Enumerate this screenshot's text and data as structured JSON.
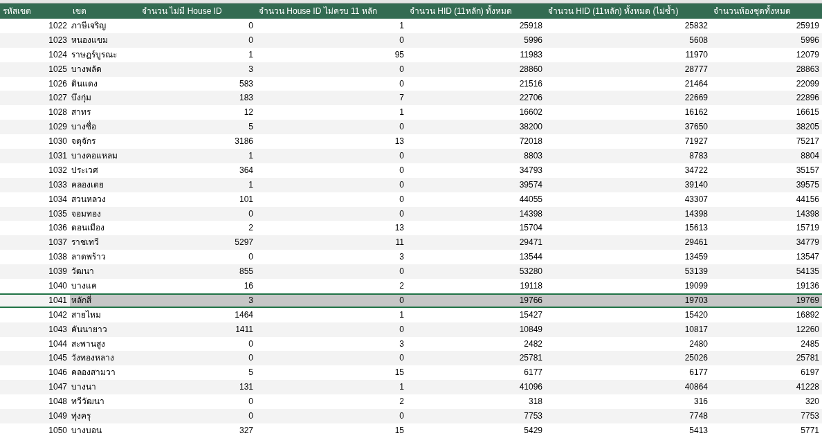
{
  "table": {
    "columns": [
      "รหัสเขต",
      "เขต",
      "จำนวน ไม่มี House ID",
      "จำนวน House ID ไม่ครบ 11 หลัก",
      "จำนวน HID (11หลัก) ทั้งหมด",
      "จำนวน HID (11หลัก) ทั้งหมด (ไม่ซ้ำ)",
      "จำนวนห้องชุดทั้งหมด"
    ],
    "rows": [
      {
        "cells": [
          "1022",
          "ภาษีเจริญ",
          "0",
          "1",
          "25918",
          "25832",
          "25919"
        ],
        "selected": false
      },
      {
        "cells": [
          "1023",
          "หนองแขม",
          "0",
          "0",
          "5996",
          "5608",
          "5996"
        ],
        "selected": false
      },
      {
        "cells": [
          "1024",
          "ราษฎร์บูรณะ",
          "1",
          "95",
          "11983",
          "11970",
          "12079"
        ],
        "selected": false
      },
      {
        "cells": [
          "1025",
          "บางพลัด",
          "3",
          "0",
          "28860",
          "28777",
          "28863"
        ],
        "selected": false
      },
      {
        "cells": [
          "1026",
          "ดินแดง",
          "583",
          "0",
          "21516",
          "21464",
          "22099"
        ],
        "selected": false
      },
      {
        "cells": [
          "1027",
          "บึงกุ่ม",
          "183",
          "7",
          "22706",
          "22669",
          "22896"
        ],
        "selected": false
      },
      {
        "cells": [
          "1028",
          "สาทร",
          "12",
          "1",
          "16602",
          "16162",
          "16615"
        ],
        "selected": false
      },
      {
        "cells": [
          "1029",
          "บางซื่อ",
          "5",
          "0",
          "38200",
          "37650",
          "38205"
        ],
        "selected": false
      },
      {
        "cells": [
          "1030",
          "จตุจักร",
          "3186",
          "13",
          "72018",
          "71927",
          "75217"
        ],
        "selected": false
      },
      {
        "cells": [
          "1031",
          "บางคอแหลม",
          "1",
          "0",
          "8803",
          "8783",
          "8804"
        ],
        "selected": false
      },
      {
        "cells": [
          "1032",
          "ประเวศ",
          "364",
          "0",
          "34793",
          "34722",
          "35157"
        ],
        "selected": false
      },
      {
        "cells": [
          "1033",
          "คลองเตย",
          "1",
          "0",
          "39574",
          "39140",
          "39575"
        ],
        "selected": false
      },
      {
        "cells": [
          "1034",
          "สวนหลวง",
          "101",
          "0",
          "44055",
          "43307",
          "44156"
        ],
        "selected": false
      },
      {
        "cells": [
          "1035",
          "จอมทอง",
          "0",
          "0",
          "14398",
          "14398",
          "14398"
        ],
        "selected": false
      },
      {
        "cells": [
          "1036",
          "ดอนเมือง",
          "2",
          "13",
          "15704",
          "15613",
          "15719"
        ],
        "selected": false
      },
      {
        "cells": [
          "1037",
          "ราชเทวี",
          "5297",
          "11",
          "29471",
          "29461",
          "34779"
        ],
        "selected": false
      },
      {
        "cells": [
          "1038",
          "ลาดพร้าว",
          "0",
          "3",
          "13544",
          "13459",
          "13547"
        ],
        "selected": false
      },
      {
        "cells": [
          "1039",
          "วัฒนา",
          "855",
          "0",
          "53280",
          "53139",
          "54135"
        ],
        "selected": false
      },
      {
        "cells": [
          "1040",
          "บางแค",
          "16",
          "2",
          "19118",
          "19099",
          "19136"
        ],
        "selected": false
      },
      {
        "cells": [
          "1041",
          "หลักสี่",
          "3",
          "0",
          "19766",
          "19703",
          "19769"
        ],
        "selected": true
      },
      {
        "cells": [
          "1042",
          "สายไหม",
          "1464",
          "1",
          "15427",
          "15420",
          "16892"
        ],
        "selected": false
      },
      {
        "cells": [
          "1043",
          "คันนายาว",
          "1411",
          "0",
          "10849",
          "10817",
          "12260"
        ],
        "selected": false
      },
      {
        "cells": [
          "1044",
          "สะพานสูง",
          "0",
          "3",
          "2482",
          "2480",
          "2485"
        ],
        "selected": false
      },
      {
        "cells": [
          "1045",
          "วังทองหลาง",
          "0",
          "0",
          "25781",
          "25026",
          "25781"
        ],
        "selected": false
      },
      {
        "cells": [
          "1046",
          "คลองสามวา",
          "5",
          "15",
          "6177",
          "6177",
          "6197"
        ],
        "selected": false
      },
      {
        "cells": [
          "1047",
          "บางนา",
          "131",
          "1",
          "41096",
          "40864",
          "41228"
        ],
        "selected": false
      },
      {
        "cells": [
          "1048",
          "ทวีวัฒนา",
          "0",
          "2",
          "318",
          "316",
          "320"
        ],
        "selected": false
      },
      {
        "cells": [
          "1049",
          "ทุ่งครุ",
          "0",
          "0",
          "7753",
          "7748",
          "7753"
        ],
        "selected": false
      },
      {
        "cells": [
          "1050",
          "บางบอน",
          "327",
          "15",
          "5429",
          "5413",
          "5771"
        ],
        "selected": false
      }
    ]
  }
}
